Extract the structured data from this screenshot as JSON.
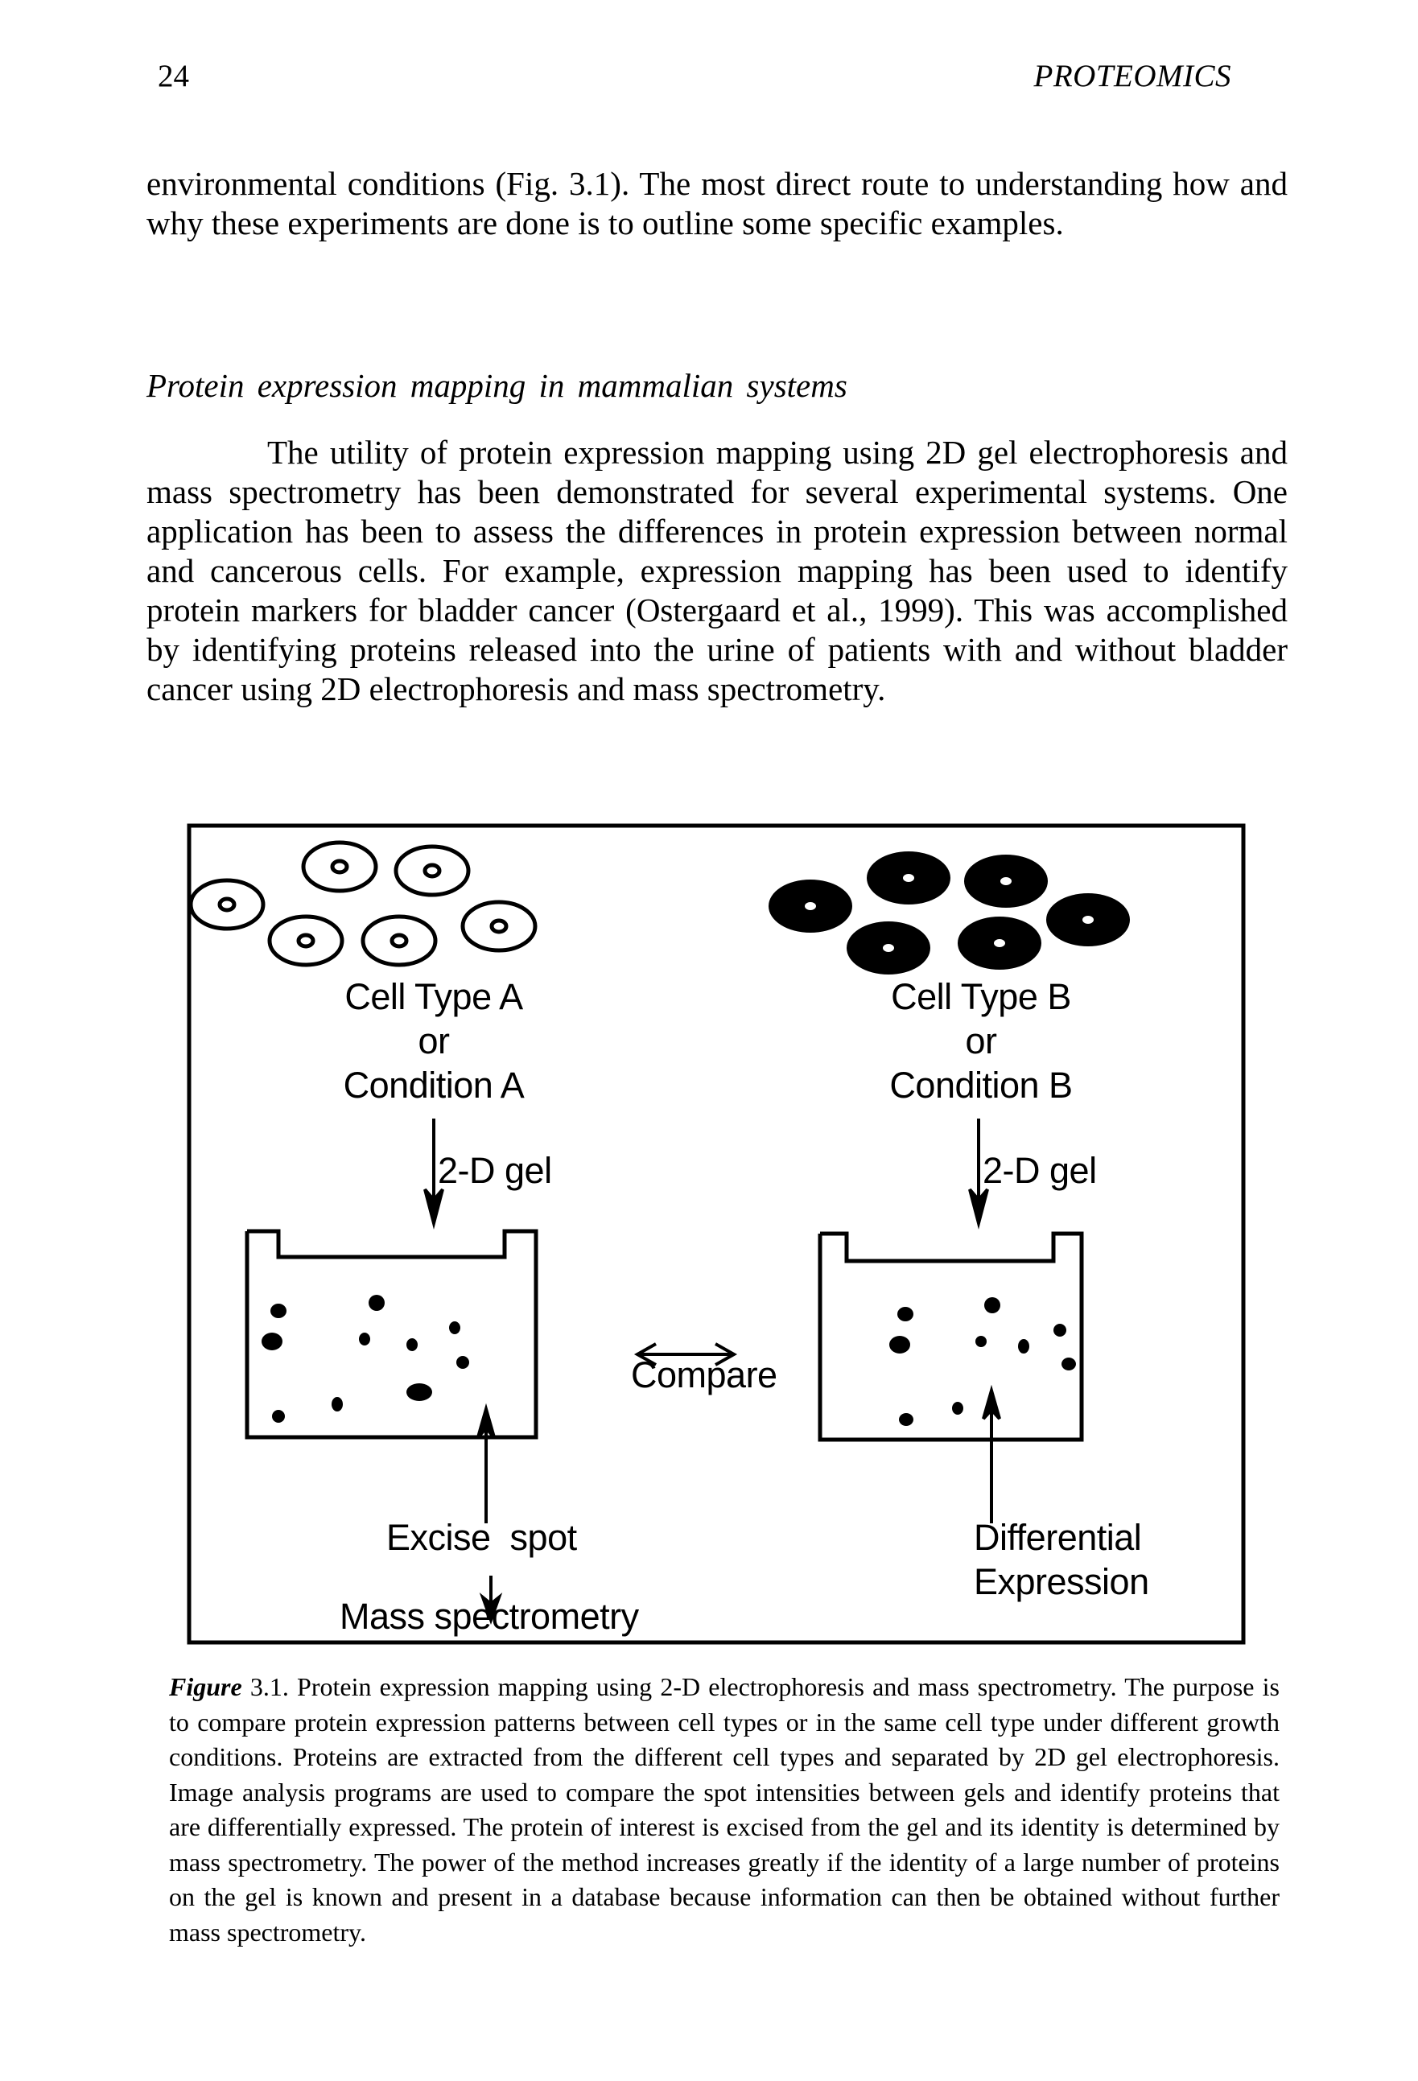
{
  "header": {
    "page_number": "24",
    "running_title": "PROTEOMICS"
  },
  "paragraphs": {
    "intro": "environmental conditions (Fig. 3.1). The most direct route to understanding how and why these experiments are done is to outline some specific examples.",
    "section_heading": "Protein expression mapping in mammalian systems",
    "body": "The utility of protein expression mapping using 2D gel electrophoresis and mass spectrometry has been demonstrated for several experimental systems. One application has been to assess the differences in protein expression between normal and cancerous cells. For example, expression mapping has been used to identify protein markers for bladder cancer (Ostergaard et al., 1999). This was accomplished by identifying proteins released into the urine of patients with and without bladder cancer using 2D electrophoresis and mass spectrometry."
  },
  "figure": {
    "cell_group_a": {
      "line1": "Cell Type A",
      "line2": "or",
      "line3": "Condition A",
      "cell_style": "outline",
      "cell_count": 6
    },
    "cell_group_b": {
      "line1": "Cell Type B",
      "line2": "or",
      "line3": "Condition B",
      "cell_style": "filled",
      "cell_count": 6
    },
    "step_label_left": "2-D gel",
    "step_label_right": "2-D gel",
    "compare_label": "Compare",
    "excise_label": "Excise  spot",
    "mass_spec_label": "Mass spectrometry",
    "differential_line1": "Differential",
    "differential_line2": "Expression",
    "gel_a_spot_count": 11,
    "gel_b_spot_count": 10
  },
  "caption": {
    "figure_word": "Figure",
    "text": " 3.1. Protein expression mapping using 2-D electrophoresis and mass spectrometry. The purpose is to compare protein expression patterns between cell types or in the same cell type under different growth conditions. Proteins are extracted from the different cell types and separated by 2D gel electrophoresis. Image analysis programs are used to compare the spot intensities between gels and identify proteins that are differentially expressed. The protein of interest is excised from the gel and its identity is determined by mass spectrometry. The power of the method increases greatly if the identity of a large number of proteins on the gel is known and present in a database because information can then be obtained without further mass spectrometry."
  }
}
